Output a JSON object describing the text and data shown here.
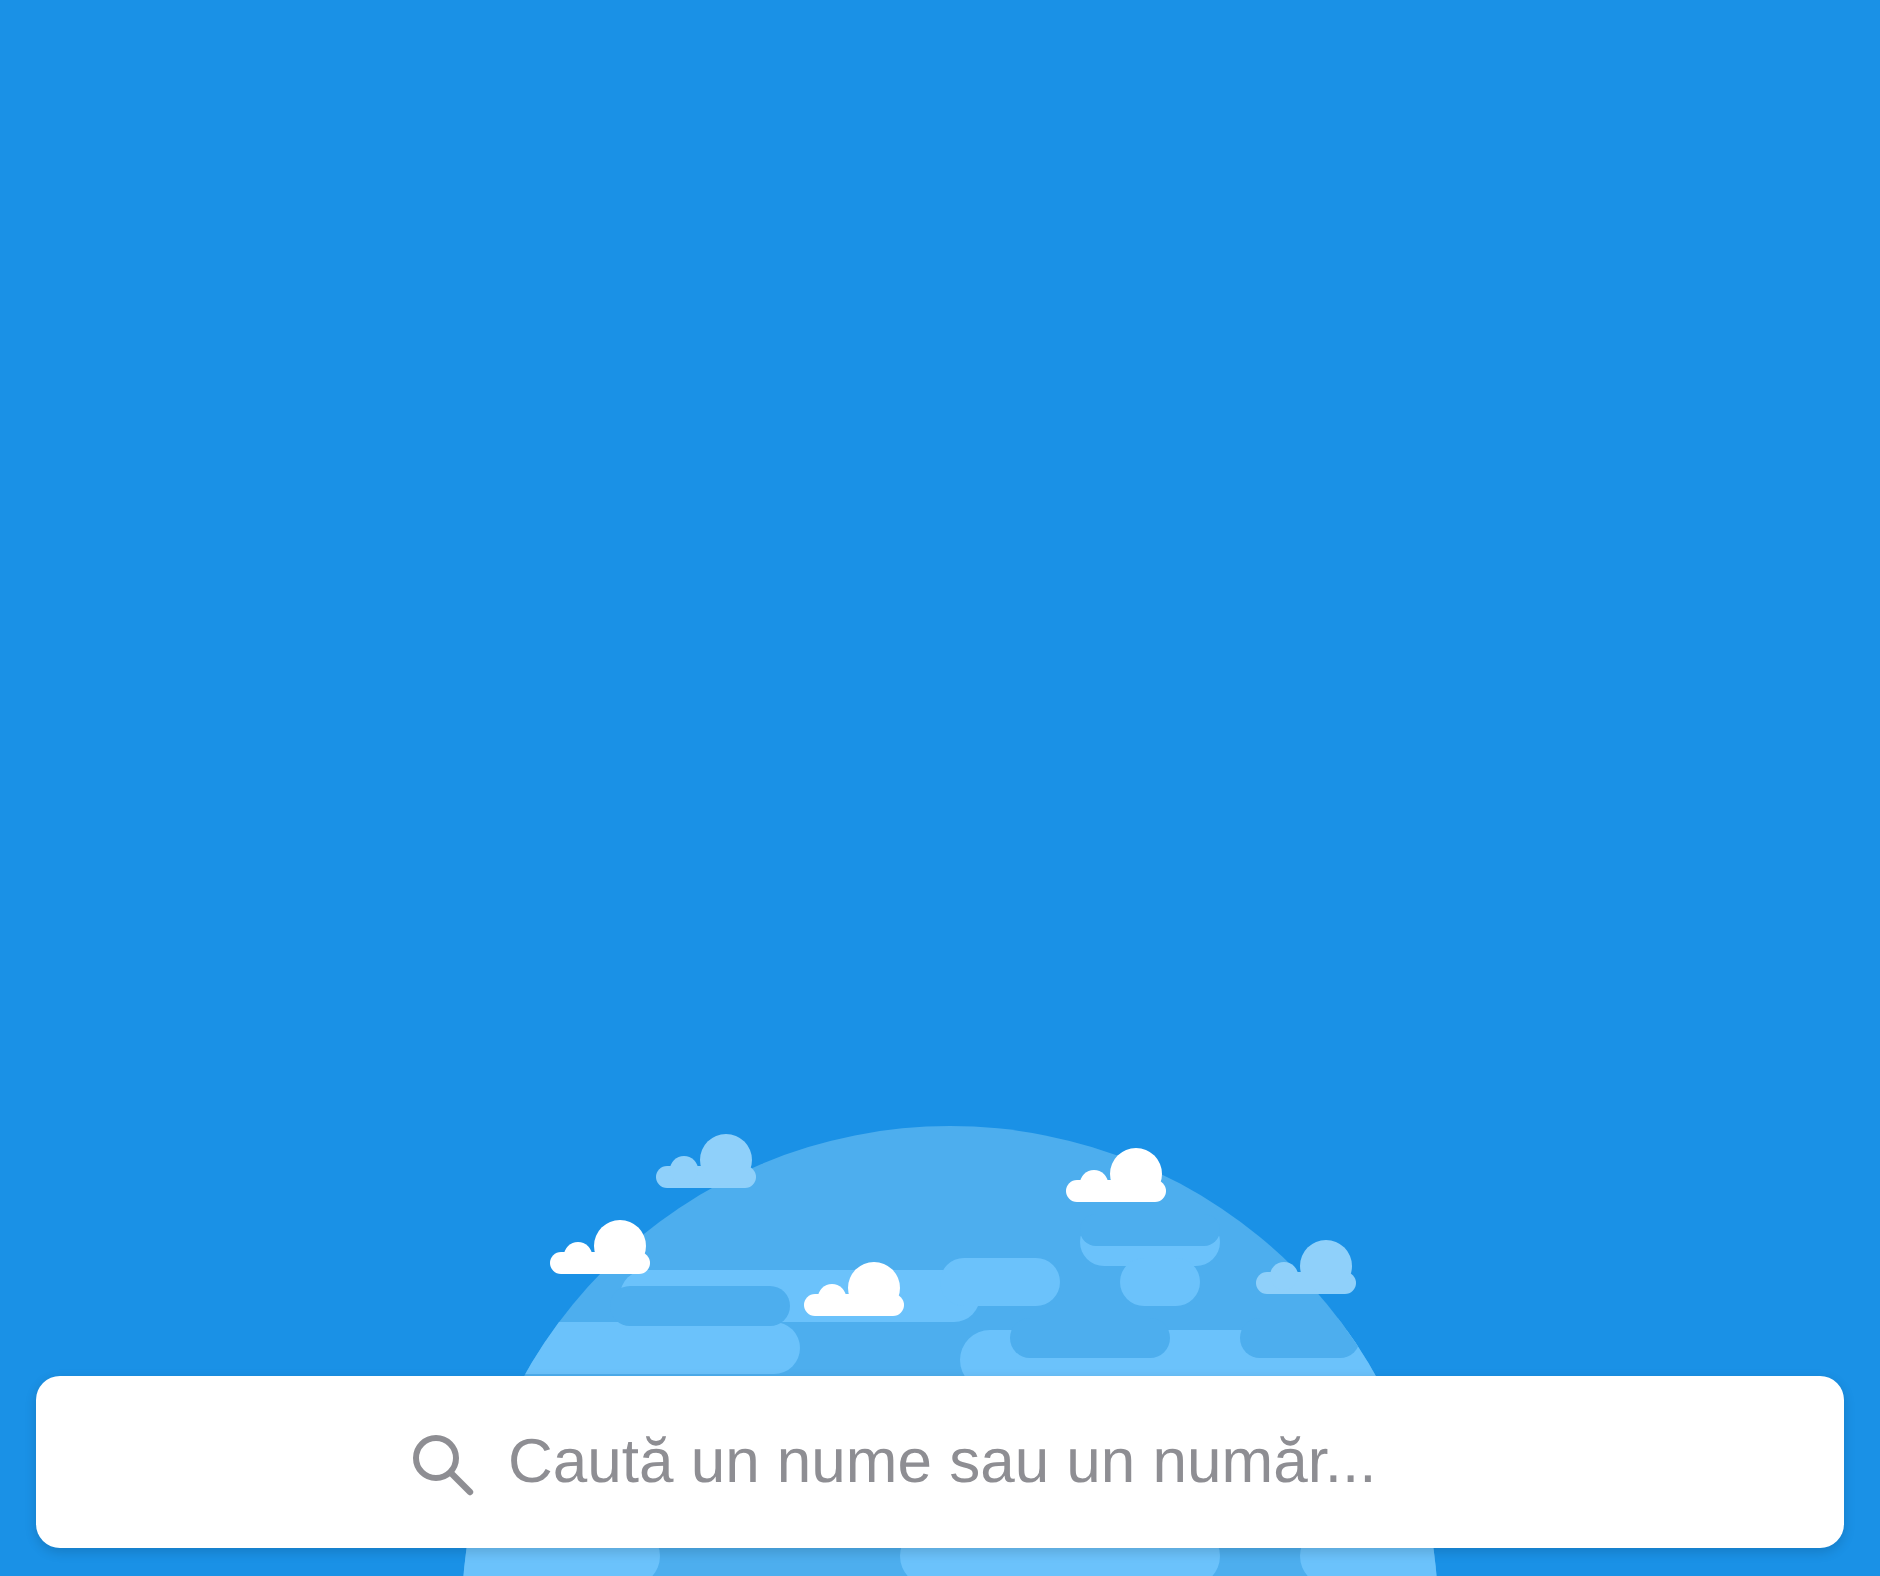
{
  "search": {
    "placeholder": "Caută un nume sau un număr..."
  }
}
